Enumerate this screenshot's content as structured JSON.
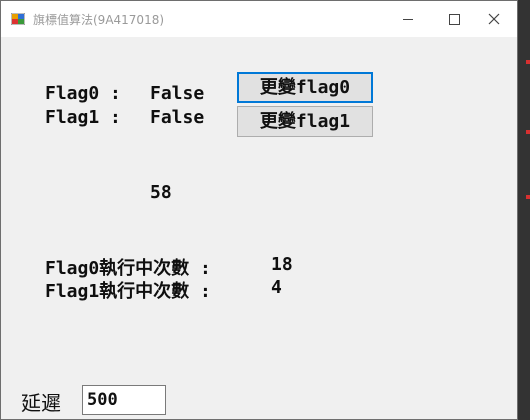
{
  "window": {
    "title": "旗標值算法(9A417018)"
  },
  "flags": [
    {
      "name": "Flag0 :",
      "value": "False",
      "button_label": "更變flag0"
    },
    {
      "name": "Flag1 :",
      "value": "False",
      "button_label": "更變flag1"
    }
  ],
  "counter": "58",
  "run_counts": [
    {
      "label": "Flag0執行中次數 :",
      "value": "18"
    },
    {
      "label": "Flag1執行中次數 :",
      "value": "4"
    }
  ],
  "delay": {
    "label": "延遲",
    "value": "500"
  },
  "colors": {
    "focus_border": "#0078d7",
    "window_bg": "#f0f0f0"
  }
}
